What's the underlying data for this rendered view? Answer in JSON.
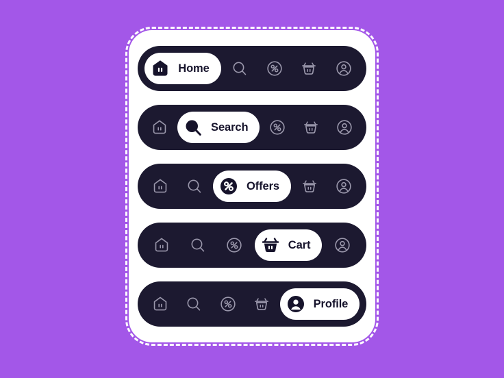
{
  "theme": {
    "background_color": "#a357e8",
    "card_color": "#ffffff",
    "bar_color": "#1c1930",
    "active_pill_color": "#ffffff",
    "active_label_color": "#16132b",
    "inactive_icon_color": "#9a97ab",
    "active_icon_fill": "#16132b",
    "active_icon_detail": "#ffffff"
  },
  "nav_items": {
    "home": "Home",
    "search": "Search",
    "offers": "Offers",
    "cart": "Cart",
    "profile": "Profile"
  },
  "bars": [
    {
      "id": "bar-home",
      "active_index": 0,
      "active_label": "Home",
      "items": [
        {
          "icon": "home-icon",
          "label": "Home",
          "state": "active"
        },
        {
          "icon": "search-icon",
          "label": "Search",
          "state": "inactive"
        },
        {
          "icon": "offers-icon",
          "label": "Offers",
          "state": "inactive"
        },
        {
          "icon": "cart-icon",
          "label": "Cart",
          "state": "inactive"
        },
        {
          "icon": "profile-icon",
          "label": "Profile",
          "state": "inactive"
        }
      ]
    },
    {
      "id": "bar-search",
      "active_index": 1,
      "active_label": "Search",
      "items": [
        {
          "icon": "home-icon",
          "label": "Home",
          "state": "inactive"
        },
        {
          "icon": "search-icon",
          "label": "Search",
          "state": "active"
        },
        {
          "icon": "offers-icon",
          "label": "Offers",
          "state": "inactive"
        },
        {
          "icon": "cart-icon",
          "label": "Cart",
          "state": "inactive"
        },
        {
          "icon": "profile-icon",
          "label": "Profile",
          "state": "inactive"
        }
      ]
    },
    {
      "id": "bar-offers",
      "active_index": 2,
      "active_label": "Offers",
      "items": [
        {
          "icon": "home-icon",
          "label": "Home",
          "state": "inactive"
        },
        {
          "icon": "search-icon",
          "label": "Search",
          "state": "inactive"
        },
        {
          "icon": "offers-icon",
          "label": "Offers",
          "state": "active"
        },
        {
          "icon": "cart-icon",
          "label": "Cart",
          "state": "inactive"
        },
        {
          "icon": "profile-icon",
          "label": "Profile",
          "state": "inactive"
        }
      ]
    },
    {
      "id": "bar-cart",
      "active_index": 3,
      "active_label": "Cart",
      "items": [
        {
          "icon": "home-icon",
          "label": "Home",
          "state": "inactive"
        },
        {
          "icon": "search-icon",
          "label": "Search",
          "state": "inactive"
        },
        {
          "icon": "offers-icon",
          "label": "Offers",
          "state": "inactive"
        },
        {
          "icon": "cart-icon",
          "label": "Cart",
          "state": "active"
        },
        {
          "icon": "profile-icon",
          "label": "Profile",
          "state": "inactive"
        }
      ]
    },
    {
      "id": "bar-profile",
      "active_index": 4,
      "active_label": "Profile",
      "items": [
        {
          "icon": "home-icon",
          "label": "Home",
          "state": "inactive"
        },
        {
          "icon": "search-icon",
          "label": "Search",
          "state": "inactive"
        },
        {
          "icon": "offers-icon",
          "label": "Offers",
          "state": "inactive"
        },
        {
          "icon": "cart-icon",
          "label": "Cart",
          "state": "inactive"
        },
        {
          "icon": "profile-icon",
          "label": "Profile",
          "state": "active"
        }
      ]
    }
  ]
}
